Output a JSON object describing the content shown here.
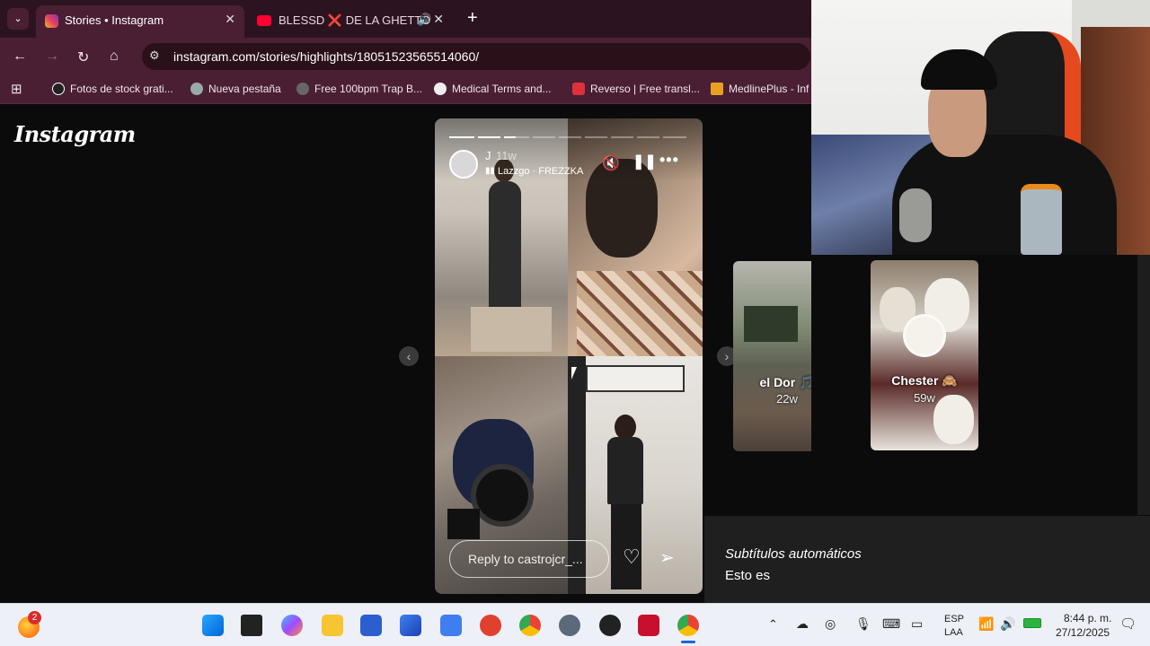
{
  "browser": {
    "tabs": [
      {
        "label": "Stories • Instagram",
        "active": true
      },
      {
        "label": "BLESSD ❌ DE LA GHETTO",
        "active": false
      }
    ],
    "url": "instagram.com/stories/highlights/18051523565514060/",
    "bookmarks": [
      {
        "label": "Fotos de stock grati...",
        "icon": "stock-icon"
      },
      {
        "label": "Nueva pestaña",
        "icon": "globe-icon"
      },
      {
        "label": "Free 100bpm Trap B...",
        "icon": "music-icon"
      },
      {
        "label": "Medical Terms and...",
        "icon": "medical-icon"
      },
      {
        "label": "Reverso | Free transl...",
        "icon": "reverso-icon"
      },
      {
        "label": "MedlinePlus - Inf",
        "icon": "medline-icon"
      }
    ]
  },
  "instagram": {
    "logo": "Instagram",
    "story": {
      "username": "J",
      "time": "11w",
      "song": "Lazzgo · FREZZKA",
      "reply_placeholder": "Reply to castrojcr_..."
    },
    "previews": [
      {
        "label": "el Dor 🎵",
        "time": "22w"
      },
      {
        "label": "Chester 🙈",
        "time": "59w"
      }
    ]
  },
  "captions": {
    "title": "Subtítulos automáticos",
    "text": "Esto es"
  },
  "taskbar": {
    "notification_badge": "2",
    "language_line1": "ESP",
    "language_line2": "LAA",
    "time": "8:44 p. m.",
    "date": "27/12/2025"
  },
  "colors": {
    "chrome_tab_bar": "#2b1420",
    "chrome_toolbar": "#4a1f33",
    "page_bg": "#0b0b0b",
    "taskbar_bg": "#eef0f7"
  }
}
